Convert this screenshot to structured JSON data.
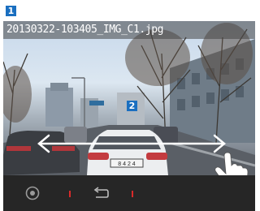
{
  "callouts": {
    "one": "1",
    "two": "2"
  },
  "photo": {
    "filename": "20130322-103405_IMG_C1.jpg"
  },
  "overlay": {
    "plate": "8 4 2 4"
  },
  "icons": {
    "record": "record-icon",
    "back": "back-icon",
    "swipe": "swipe-gesture-icon",
    "arrows": "left-right-arrow-icon"
  },
  "colors": {
    "callout": "#1a6fc0",
    "toolbar": "#262626",
    "separator": "#d92a2a"
  }
}
